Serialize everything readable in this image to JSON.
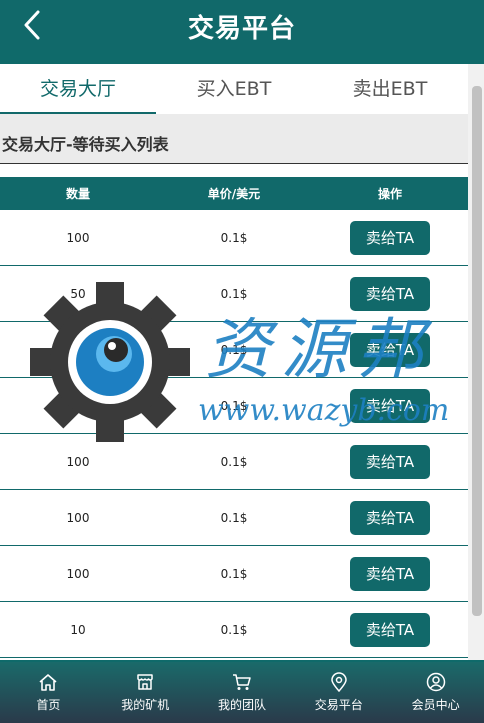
{
  "header": {
    "title": "交易平台"
  },
  "tabs": [
    {
      "label": "交易大厅",
      "active": true
    },
    {
      "label": "买入EBT",
      "active": false
    },
    {
      "label": "卖出EBT",
      "active": false
    }
  ],
  "section": {
    "title": "交易大厅-等待买入列表"
  },
  "table": {
    "headers": [
      "数量",
      "单价/美元",
      "操作"
    ],
    "rows": [
      {
        "quantity": "100",
        "price": "0.1$",
        "action": "卖给TA"
      },
      {
        "quantity": "50",
        "price": "0.1$",
        "action": "卖给TA"
      },
      {
        "quantity": "2",
        "price": "0.1$",
        "action": "卖给TA"
      },
      {
        "quantity": "10",
        "price": "0.1$",
        "action": "卖给TA"
      },
      {
        "quantity": "100",
        "price": "0.1$",
        "action": "卖给TA"
      },
      {
        "quantity": "100",
        "price": "0.1$",
        "action": "卖给TA"
      },
      {
        "quantity": "100",
        "price": "0.1$",
        "action": "卖给TA"
      },
      {
        "quantity": "10",
        "price": "0.1$",
        "action": "卖给TA"
      }
    ]
  },
  "watermark": {
    "text": "资源邦",
    "url": "www.wazyb.com"
  },
  "nav": [
    {
      "label": "首页",
      "icon": "home-icon"
    },
    {
      "label": "我的矿机",
      "icon": "store-icon"
    },
    {
      "label": "我的团队",
      "icon": "cart-icon"
    },
    {
      "label": "交易平台",
      "icon": "location-pin-icon"
    },
    {
      "label": "会员中心",
      "icon": "user-icon"
    }
  ],
  "colors": {
    "primary": "#11696a",
    "sectionBg": "#ebebeb",
    "watermarkBlue": "#1d7fc2"
  }
}
